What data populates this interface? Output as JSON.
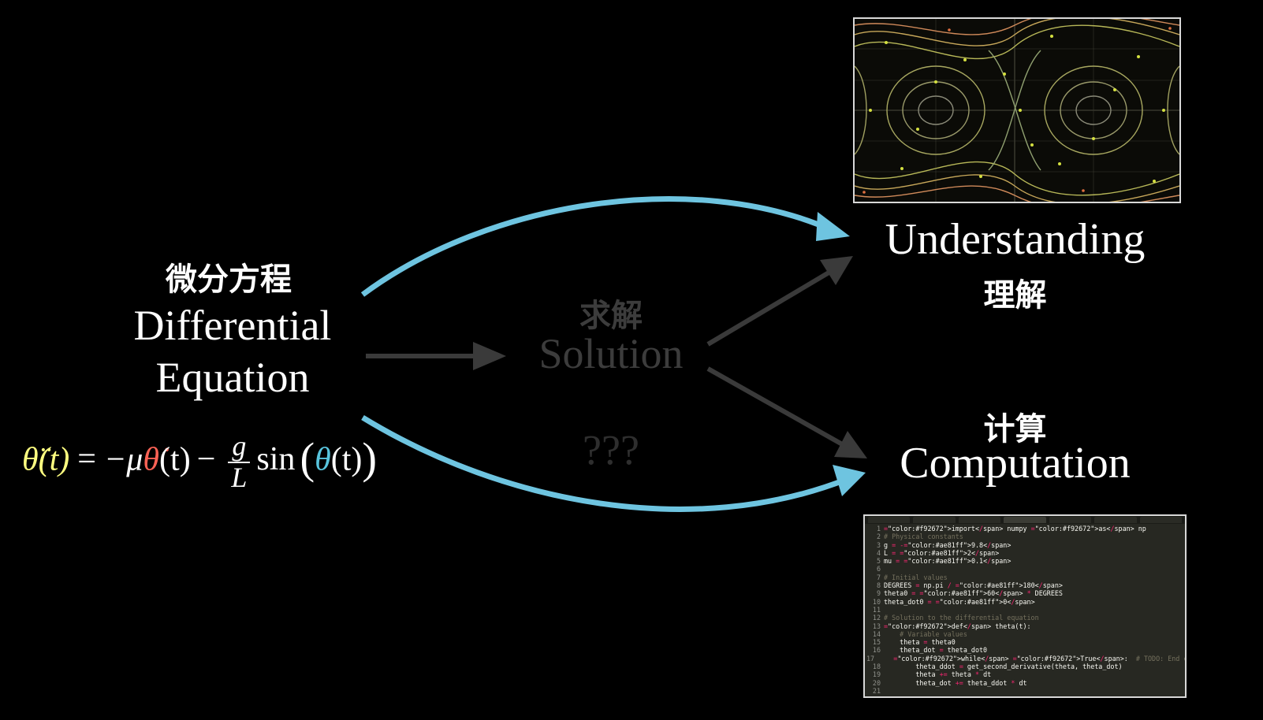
{
  "differential_equation": {
    "label_zh": "微分方程",
    "label_en_line1": "Differential",
    "label_en_line2": "Equation"
  },
  "equation": {
    "lhs": "θ̈(t)",
    "equals": "=",
    "term1": "−μ",
    "theta_dot": "θ̇",
    "t1": "(t)",
    "minus": "−",
    "frac_num": "g",
    "frac_den": "L",
    "sin": "sin",
    "paren_open": "(",
    "theta": "θ",
    "t2": "(t)",
    "paren_close": ")",
    "colors": {
      "theta_ddot": "#ffff80",
      "theta_dot": "#fc6255",
      "theta": "#58c4dd"
    }
  },
  "solution": {
    "label_zh": "求解",
    "label_en": "Solution",
    "unknown": "???"
  },
  "understanding": {
    "label_en": "Understanding",
    "label_zh": "理解"
  },
  "computation": {
    "label_zh": "计算",
    "label_en": "Computation"
  },
  "colors": {
    "arrow_blue": "#6ec4e0",
    "arrow_gray": "#3a3a3a",
    "background": "#000000"
  },
  "code": [
    {
      "n": "1",
      "text": "import numpy as np"
    },
    {
      "n": "2",
      "text": "# Physical constants"
    },
    {
      "n": "3",
      "text": "g = -9.8"
    },
    {
      "n": "4",
      "text": "L = 2"
    },
    {
      "n": "5",
      "text": "mu = 0.1"
    },
    {
      "n": "6",
      "text": ""
    },
    {
      "n": "7",
      "text": "# Initial values"
    },
    {
      "n": "8",
      "text": "DEGREES = np.pi / 180"
    },
    {
      "n": "9",
      "text": "theta0 = 60 * DEGREES"
    },
    {
      "n": "10",
      "text": "theta_dot0 = 0"
    },
    {
      "n": "11",
      "text": ""
    },
    {
      "n": "12",
      "text": "# Solution to the differential equation"
    },
    {
      "n": "13",
      "text": "def theta(t):"
    },
    {
      "n": "14",
      "text": "    # Variable values"
    },
    {
      "n": "15",
      "text": "    theta = theta0"
    },
    {
      "n": "16",
      "text": "    theta_dot = theta_dot0"
    },
    {
      "n": "17",
      "text": "    while True:  # TODO: End condition"
    },
    {
      "n": "18",
      "text": "        theta_ddot = get_second_derivative(theta, theta_dot)"
    },
    {
      "n": "19",
      "text": "        theta += theta * dt"
    },
    {
      "n": "20",
      "text": "        theta_dot += theta_ddot * dt"
    },
    {
      "n": "21",
      "text": ""
    }
  ]
}
